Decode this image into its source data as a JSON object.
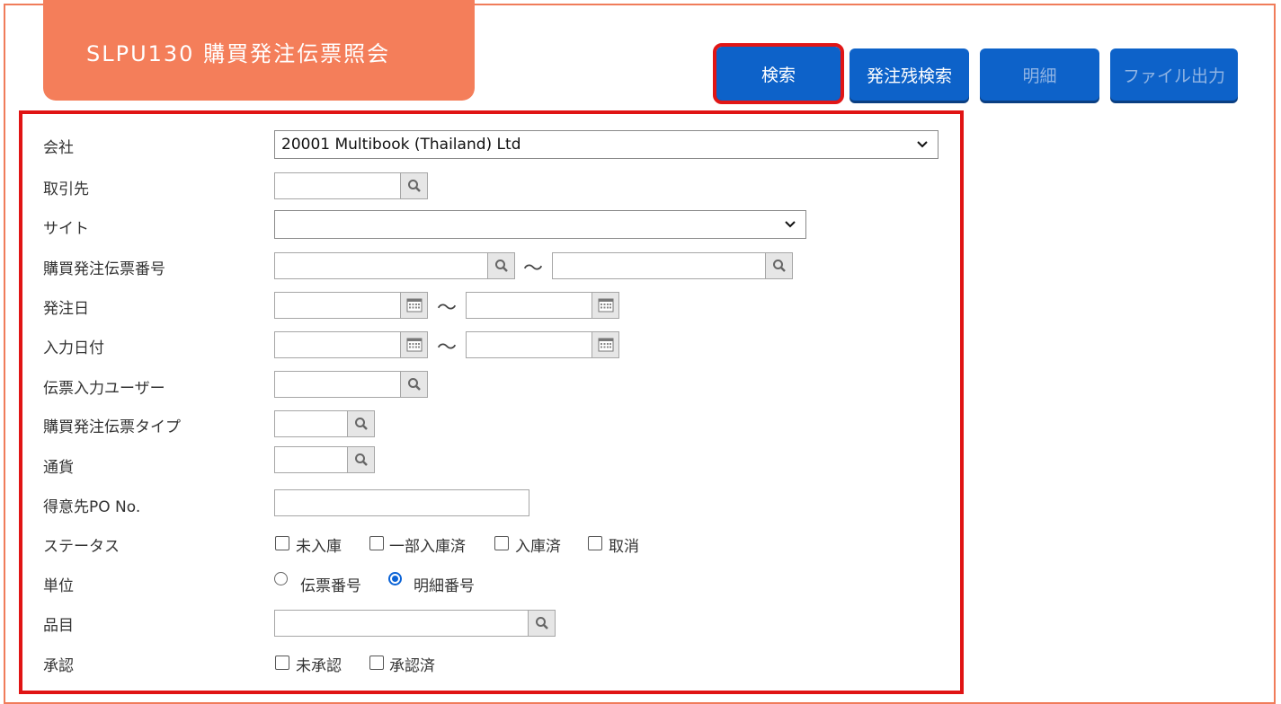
{
  "title": "SLPU130 購買発注伝票照会",
  "toolbar": {
    "search": "検索",
    "remaining_search": "発注残検索",
    "detail": "明細",
    "file_output": "ファイル出力"
  },
  "form": {
    "company": {
      "label": "会社",
      "value": "20001 Multibook (Thailand) Ltd"
    },
    "supplier": {
      "label": "取引先"
    },
    "site": {
      "label": "サイト",
      "value": ""
    },
    "po_number": {
      "label": "購買発注伝票番号",
      "sep": "～"
    },
    "order_date": {
      "label": "発注日",
      "sep": "～"
    },
    "entry_date": {
      "label": "入力日付",
      "sep": "～"
    },
    "entry_user": {
      "label": "伝票入力ユーザー"
    },
    "po_type": {
      "label": "購買発注伝票タイプ"
    },
    "currency": {
      "label": "通貨"
    },
    "customer_po": {
      "label": "得意先PO No."
    },
    "status": {
      "label": "ステータス",
      "options": [
        "未入庫",
        "一部入庫済",
        "入庫済",
        "取消"
      ]
    },
    "unit": {
      "label": "単位",
      "options": [
        "伝票番号",
        "明細番号"
      ],
      "selected": "明細番号"
    },
    "item": {
      "label": "品目"
    },
    "approval": {
      "label": "承認",
      "options": [
        "未承認",
        "承認済"
      ]
    }
  },
  "colors": {
    "accent": "#f47e5a",
    "button": "#0d62c9",
    "highlight": "#e01414"
  },
  "icons": {
    "lookup": "search-icon",
    "date": "calendar-icon",
    "dropdown": "chevron-down-icon"
  }
}
